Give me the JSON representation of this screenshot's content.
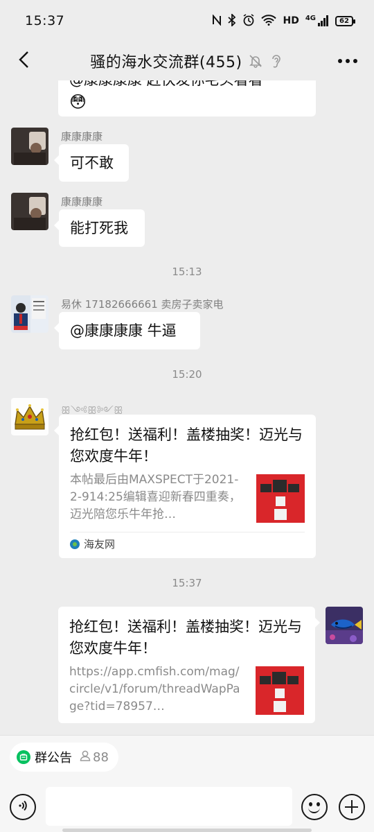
{
  "status_bar": {
    "time": "15:37",
    "network_label": "HD",
    "signal_label": "4G",
    "battery": "62",
    "icons": [
      "nfc-icon",
      "bluetooth-icon",
      "alarm-icon",
      "wifi-icon",
      "signal-icon",
      "battery-icon"
    ]
  },
  "header": {
    "title": "骚的海水交流群(455)",
    "icons": [
      "back-icon",
      "mute-bell-icon",
      "ear-icon",
      "more-icon"
    ]
  },
  "messages": [
    {
      "type": "text",
      "sender": "",
      "text": "@康康康康 赶快发你宅头看看",
      "trailing_emoji": "😳"
    },
    {
      "type": "text",
      "sender": "康康康康",
      "text": "可不敢"
    },
    {
      "type": "text",
      "sender": "康康康康",
      "text": "能打死我"
    },
    {
      "type": "timestamp",
      "text": "15:13"
    },
    {
      "type": "text",
      "sender": "易休 17182666661 卖房子卖家电",
      "text": "@康康康康  牛逼"
    },
    {
      "type": "timestamp",
      "text": "15:20"
    },
    {
      "type": "link_card",
      "sender": "ꕥ༺ꕥ༻ꕥ",
      "title": "抢红包！送福利！盖楼抽奖！迈光与您欢度牛年！",
      "description": "本帖最后由MAXSPECT于2021-2-914:25编辑喜迎新春四重奏，迈光陪您乐牛年抢…",
      "source": "海友网"
    },
    {
      "type": "timestamp",
      "text": "15:37"
    },
    {
      "type": "link_card",
      "sender": "",
      "title": "抢红包！送福利！盖楼抽奖！迈光与您欢度牛年！",
      "description": "https://app.cmfish.com/mag/circle/v1/forum/threadWapPage?tid=78957…"
    }
  ],
  "footer": {
    "notice_label": "群公告",
    "member_count": "88",
    "input_placeholder": "",
    "icons": [
      "voice-icon",
      "emoji-icon",
      "plus-icon"
    ]
  },
  "colors": {
    "background": "#ededed",
    "bubble": "#ffffff",
    "accent_green": "#07c160",
    "muted_text": "#8a8a8a"
  }
}
